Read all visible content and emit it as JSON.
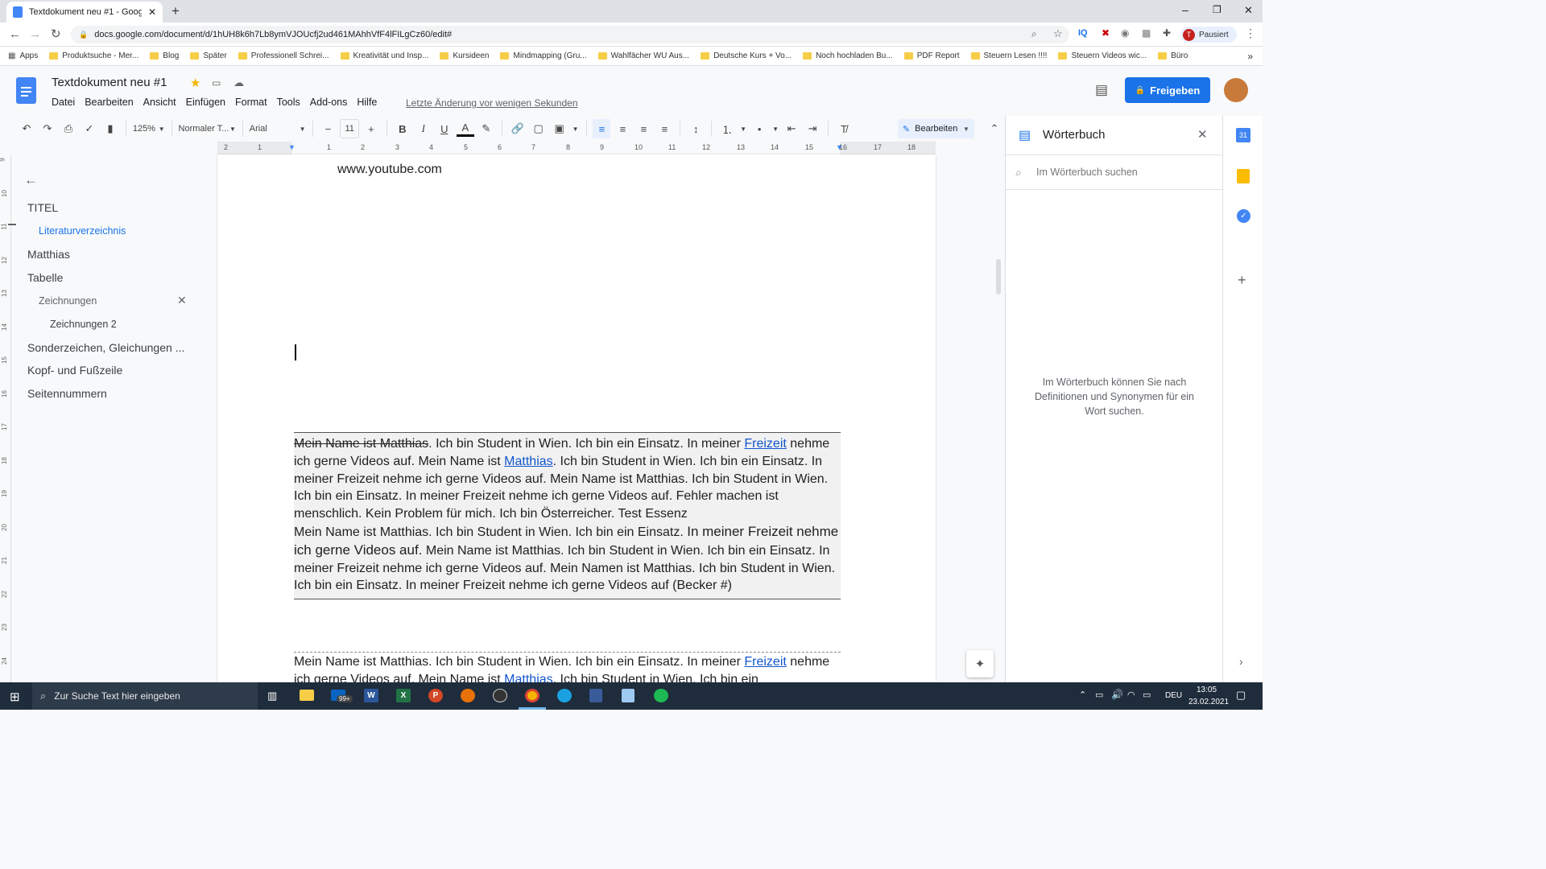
{
  "browser": {
    "tab_title": "Textdokument neu #1 - Google D",
    "url": "docs.google.com/document/d/1hUH8k6h7Lb8ymVJOUcfj2ud461MAhhVfF4lFILgCz60/edit#",
    "profile_label": "Pausiert",
    "profile_initial": "T",
    "bookmarks": [
      "Apps",
      "Produktsuche - Mer...",
      "Blog",
      "Später",
      "Professionell Schrei...",
      "Kreativität und Insp...",
      "Kursideen",
      "Mindmapping (Gru...",
      "Wahlfächer WU Aus...",
      "Deutsche Kurs + Vo...",
      "Noch hochladen Bu...",
      "PDF Report",
      "Steuern Lesen !!!!",
      "Steuern Videos wic...",
      "Büro"
    ]
  },
  "doc": {
    "title": "Textdokument neu #1",
    "menu": [
      "Datei",
      "Bearbeiten",
      "Ansicht",
      "Einfügen",
      "Format",
      "Tools",
      "Add-ons",
      "Hilfe"
    ],
    "last_edit": "Letzte Änderung vor wenigen Sekunden",
    "share_label": "Freigeben"
  },
  "toolbar": {
    "zoom": "125%",
    "style": "Normaler T...",
    "font": "Arial",
    "font_size": "11",
    "mode": "Bearbeiten"
  },
  "ruler": {
    "marks": [
      "2",
      "1",
      "1",
      "2",
      "3",
      "4",
      "5",
      "6",
      "7",
      "8",
      "9",
      "10",
      "11",
      "12",
      "13",
      "14",
      "15",
      "16",
      "17",
      "18"
    ]
  },
  "vruler": {
    "marks": [
      "9",
      "10",
      "11",
      "12",
      "13",
      "14",
      "15",
      "16",
      "17",
      "18",
      "19",
      "20",
      "21",
      "22",
      "23",
      "24"
    ]
  },
  "outline": {
    "items": [
      {
        "label": "TITEL"
      },
      {
        "label": "Literaturverzeichnis"
      },
      {
        "label": "Matthias"
      },
      {
        "label": "Tabelle"
      },
      {
        "label": "Zeichnungen"
      },
      {
        "label": "Zeichnungen 2"
      },
      {
        "label": "Sonderzeichen, Gleichungen ..."
      },
      {
        "label": "Kopf- und Fußzeile"
      },
      {
        "label": "Seitennummern"
      }
    ]
  },
  "page": {
    "url_line": "www.youtube.com",
    "block1": {
      "strike": "Mein Name ist Matthias",
      "t1": ". Ich bin Student in Wien. Ich bin ein Einsatz. In meiner ",
      "link1": "Freizeit",
      "t2": " nehme ich gerne Videos auf. Mein Name ist ",
      "link2": "Matthias",
      "t3": ". Ich bin Student in Wien. Ich bin ein Einsatz. In meiner Freizeit nehme ich gerne Videos auf. Mein Name ist Matthias. Ich bin Student in Wien. Ich bin ein Einsatz. In meiner Freizeit nehme ich gerne Videos auf. Fehler machen ist menschlich. Kein Problem für mich. Ich bin Österreicher. Test Essenz",
      "t4a": "Mein Name ist Matthias. Ich bin Student in Wien. Ich bin ein Einsatz. ",
      "t4b": "In meiner Freizeit nehme ich gerne Videos auf.",
      "t4c": " Mein Name ist Matthias. Ich bin Student in Wien. Ich bin ein Einsatz. In meiner Freizeit nehme ich gerne Videos auf. Mein Namen ist Matthias. Ich bin Student in Wien. Ich bin ein Einsatz. In meiner Freizeit nehme ich gerne Videos auf (Becker #)"
    },
    "block2": {
      "t1": "Mein Name ist Matthias. Ich bin Student in Wien. Ich bin ein Einsatz. In meiner ",
      "link1": "Freizeit",
      "t2": " nehme ich gerne Videos auf. Mein Name ist ",
      "link2": "Matthias",
      "t3": ". Ich bin Student in Wien. Ich bin ein"
    }
  },
  "dictionary": {
    "title": "Wörterbuch",
    "search_placeholder": "Im Wörterbuch suchen",
    "empty_text": "Im Wörterbuch können Sie nach Definitionen und Synonymen für ein Wort suchen."
  },
  "taskbar": {
    "search_placeholder": "Zur Suche Text hier eingeben",
    "mail_badge": "99+",
    "lang": "DEU",
    "time": "13:05",
    "date": "23.02.2021"
  },
  "colors": {
    "accent": "#1a73e8",
    "docs_blue": "#4285f4",
    "link": "#1155cc",
    "taskbar": "#1f2c3c"
  }
}
